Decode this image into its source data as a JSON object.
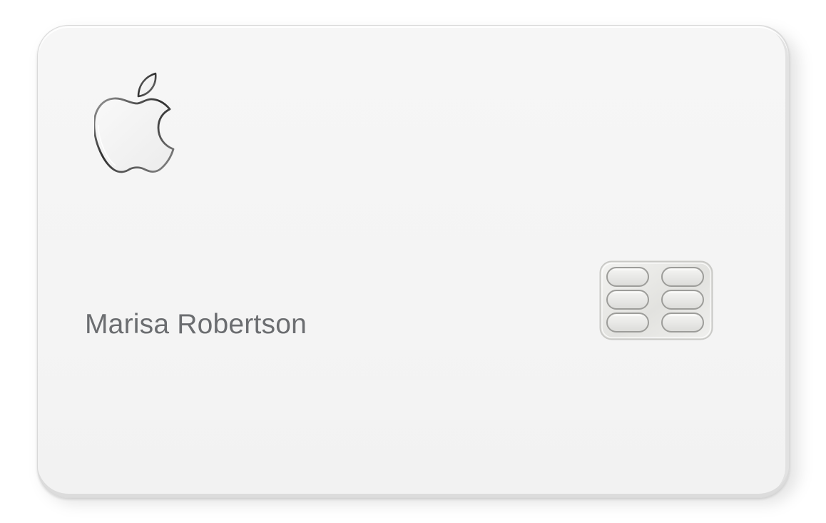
{
  "card": {
    "cardholder_name": "Marisa Robertson",
    "logo_icon": "apple-logo-icon",
    "chip_icon": "emv-chip-icon"
  },
  "colors": {
    "card_surface": "#f5f5f5",
    "name_text": "#6b6d70",
    "chip_metal": "#e4e4e2",
    "logo_outline": "#4a4a4a"
  }
}
